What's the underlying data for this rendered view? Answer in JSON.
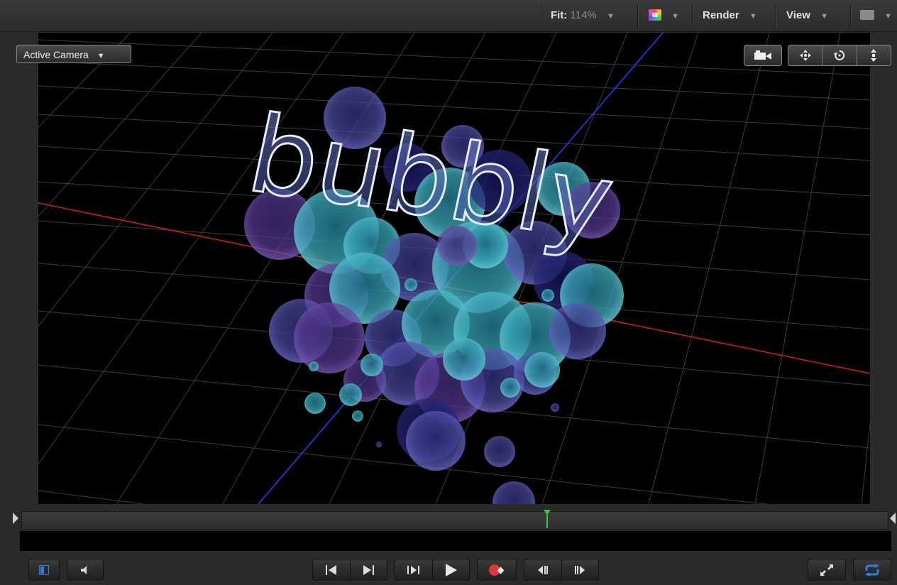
{
  "toolbar": {
    "fit_label": "Fit:",
    "fit_value": "114%",
    "render_label": "Render",
    "view_label": "View",
    "dropdown_arrow": "▼"
  },
  "viewer": {
    "camera_select": "Active Camera",
    "canvas_text": "bubbly",
    "tools": [
      "camera-icon",
      "move-icon",
      "orbit-icon",
      "dolly-icon"
    ]
  },
  "transport": {
    "buttons": [
      "toggle-panel-icon",
      "audio-icon",
      "go-to-start-icon",
      "go-to-end-icon",
      "play-range-icon",
      "play-icon",
      "record-icon",
      "previous-frame-icon",
      "next-frame-icon",
      "fullscreen-icon",
      "loop-icon"
    ]
  },
  "colors": {
    "x_axis": "#d02020",
    "z_axis": "#2a3cff",
    "playhead": "#3ec43e",
    "loop_active": "#2e7fe0",
    "record": "#e0353a"
  }
}
